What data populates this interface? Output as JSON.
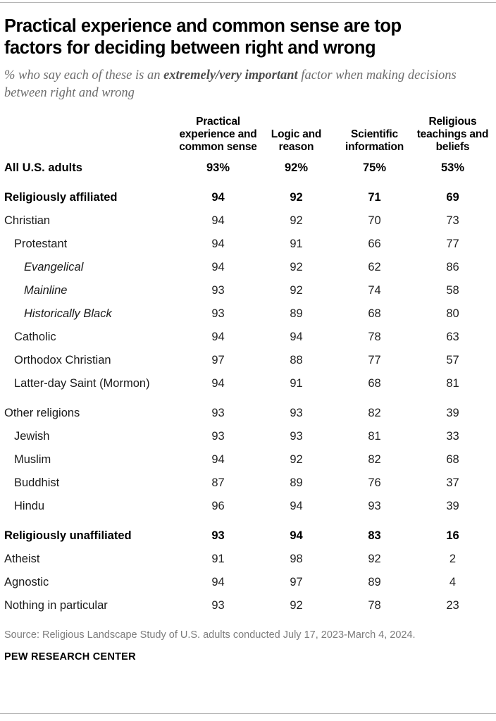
{
  "title": "Practical experience and common sense are top factors for deciding between right and wrong",
  "subtitle": {
    "part1": "% who say each of these is an ",
    "emphasis": "extremely/very important",
    "part2": " factor when making decisions between right and wrong"
  },
  "footer": {
    "source": "Source: Religious Landscape Study of U.S. adults conducted July 17, 2023-March 4, 2024.",
    "brand": "PEW RESEARCH CENTER"
  },
  "colors": {
    "rule": "#b5b5b5",
    "title": "#000000",
    "subtitle": "#6c6c6c",
    "source": "#7d7d7d",
    "body_text": "#222222"
  },
  "chart_data": {
    "type": "table",
    "title": "Practical experience and common sense are top factors for deciding between right and wrong",
    "subtitle": "% who say each of these is an extremely/very important factor when making decisions between right and wrong",
    "row_header": "",
    "categories": [
      "Practical experience and common sense",
      "Logic and reason",
      "Scientific information",
      "Religious teachings and beliefs"
    ],
    "column_headers": [
      "Practical experience and common sense",
      "Logic and reason",
      "Scientific information",
      "Religious teachings and beliefs"
    ],
    "rows": [
      {
        "label": "All U.S. adults",
        "indent": 0,
        "bold": true,
        "italic": false,
        "gap_before": false,
        "values": [
          "93%",
          "92%",
          "75%",
          "53%"
        ]
      },
      {
        "label": "Religiously affiliated",
        "indent": 0,
        "bold": true,
        "italic": false,
        "gap_before": true,
        "values": [
          "94",
          "92",
          "71",
          "69"
        ]
      },
      {
        "label": "Christian",
        "indent": 0,
        "bold": false,
        "italic": false,
        "gap_before": false,
        "values": [
          "94",
          "92",
          "70",
          "73"
        ]
      },
      {
        "label": "Protestant",
        "indent": 1,
        "bold": false,
        "italic": false,
        "gap_before": false,
        "values": [
          "94",
          "91",
          "66",
          "77"
        ]
      },
      {
        "label": "Evangelical",
        "indent": 2,
        "bold": false,
        "italic": true,
        "gap_before": false,
        "values": [
          "94",
          "92",
          "62",
          "86"
        ]
      },
      {
        "label": "Mainline",
        "indent": 2,
        "bold": false,
        "italic": true,
        "gap_before": false,
        "values": [
          "93",
          "92",
          "74",
          "58"
        ]
      },
      {
        "label": "Historically Black",
        "indent": 2,
        "bold": false,
        "italic": true,
        "gap_before": false,
        "values": [
          "93",
          "89",
          "68",
          "80"
        ]
      },
      {
        "label": "Catholic",
        "indent": 1,
        "bold": false,
        "italic": false,
        "gap_before": false,
        "values": [
          "94",
          "94",
          "78",
          "63"
        ]
      },
      {
        "label": "Orthodox Christian",
        "indent": 1,
        "bold": false,
        "italic": false,
        "gap_before": false,
        "values": [
          "97",
          "88",
          "77",
          "57"
        ]
      },
      {
        "label": "Latter-day Saint (Mormon)",
        "indent": 1,
        "bold": false,
        "italic": false,
        "gap_before": false,
        "values": [
          "94",
          "91",
          "68",
          "81"
        ]
      },
      {
        "label": "Other religions",
        "indent": 0,
        "bold": false,
        "italic": false,
        "gap_before": true,
        "values": [
          "93",
          "93",
          "82",
          "39"
        ]
      },
      {
        "label": "Jewish",
        "indent": 1,
        "bold": false,
        "italic": false,
        "gap_before": false,
        "values": [
          "93",
          "93",
          "81",
          "33"
        ]
      },
      {
        "label": "Muslim",
        "indent": 1,
        "bold": false,
        "italic": false,
        "gap_before": false,
        "values": [
          "94",
          "92",
          "82",
          "68"
        ]
      },
      {
        "label": "Buddhist",
        "indent": 1,
        "bold": false,
        "italic": false,
        "gap_before": false,
        "values": [
          "87",
          "89",
          "76",
          "37"
        ]
      },
      {
        "label": "Hindu",
        "indent": 1,
        "bold": false,
        "italic": false,
        "gap_before": false,
        "values": [
          "96",
          "94",
          "93",
          "39"
        ]
      },
      {
        "label": "Religiously unaffiliated",
        "indent": 0,
        "bold": true,
        "italic": false,
        "gap_before": true,
        "values": [
          "93",
          "94",
          "83",
          "16"
        ]
      },
      {
        "label": "Atheist",
        "indent": 0,
        "bold": false,
        "italic": false,
        "gap_before": false,
        "values": [
          "91",
          "98",
          "92",
          "2"
        ]
      },
      {
        "label": "Agnostic",
        "indent": 0,
        "bold": false,
        "italic": false,
        "gap_before": false,
        "values": [
          "94",
          "97",
          "89",
          "4"
        ]
      },
      {
        "label": "Nothing in particular",
        "indent": 0,
        "bold": false,
        "italic": false,
        "gap_before": false,
        "values": [
          "93",
          "92",
          "78",
          "23"
        ]
      }
    ]
  }
}
